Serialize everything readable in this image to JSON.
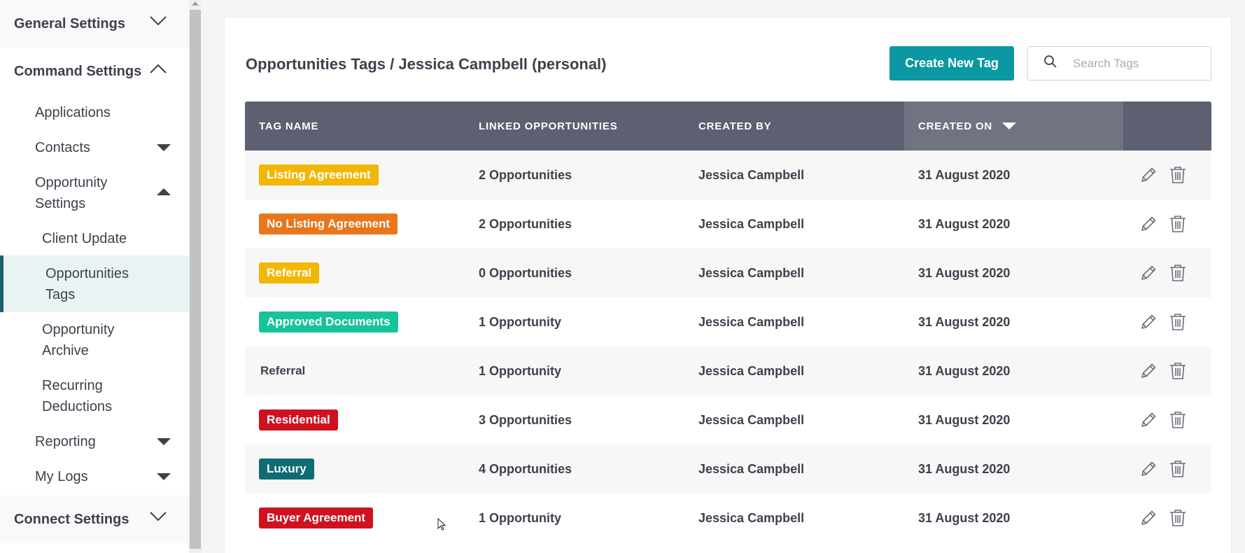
{
  "sidebar": {
    "general_settings": "General Settings",
    "command_settings": "Command Settings",
    "items": {
      "applications": "Applications",
      "contacts": "Contacts",
      "opportunity_settings_1": "Opportunity",
      "opportunity_settings_2": "Settings",
      "client_update": "Client Update",
      "opportunities_tags_1": "Opportunities",
      "opportunities_tags_2": "Tags",
      "opportunity_archive_1": "Opportunity",
      "opportunity_archive_2": "Archive",
      "recurring_deductions_1": "Recurring",
      "recurring_deductions_2": "Deductions",
      "reporting": "Reporting",
      "my_logs": "My Logs"
    },
    "connect_settings": "Connect Settings"
  },
  "header": {
    "title": "Opportunities Tags / Jessica Campbell (personal)",
    "create_button": "Create New Tag",
    "search_placeholder": "Search Tags"
  },
  "table": {
    "columns": [
      "TAG NAME",
      "LINKED OPPORTUNITIES",
      "CREATED BY",
      "CREATED ON"
    ],
    "sorted_column": "CREATED ON",
    "rows": [
      {
        "tag": "Listing Agreement",
        "color": "#f2b705",
        "linked": "2 Opportunities",
        "created_by": "Jessica Campbell",
        "created_on": "31 August 2020"
      },
      {
        "tag": "No Listing Agreement",
        "color": "#e8761c",
        "linked": "2 Opportunities",
        "created_by": "Jessica Campbell",
        "created_on": "31 August 2020"
      },
      {
        "tag": "Referral",
        "color": "#f2b705",
        "linked": "0 Opportunities",
        "created_by": "Jessica Campbell",
        "created_on": "31 August 2020"
      },
      {
        "tag": "Approved Documents",
        "color": "#17c39a",
        "linked": "1 Opportunity",
        "created_by": "Jessica Campbell",
        "created_on": "31 August 2020"
      },
      {
        "tag": "Referral",
        "color": "",
        "linked": "1 Opportunity",
        "created_by": "Jessica Campbell",
        "created_on": "31 August 2020"
      },
      {
        "tag": "Residential",
        "color": "#d0111f",
        "linked": "3 Opportunities",
        "created_by": "Jessica Campbell",
        "created_on": "31 August 2020"
      },
      {
        "tag": "Luxury",
        "color": "#0f6b74",
        "linked": "4 Opportunities",
        "created_by": "Jessica Campbell",
        "created_on": "31 August 2020"
      },
      {
        "tag": "Buyer Agreement",
        "color": "#d0111f",
        "linked": "1 Opportunity",
        "created_by": "Jessica Campbell",
        "created_on": "31 August 2020"
      }
    ]
  },
  "icons": {
    "edit": "pencil-icon",
    "delete": "trash-icon",
    "search": "search-icon"
  }
}
